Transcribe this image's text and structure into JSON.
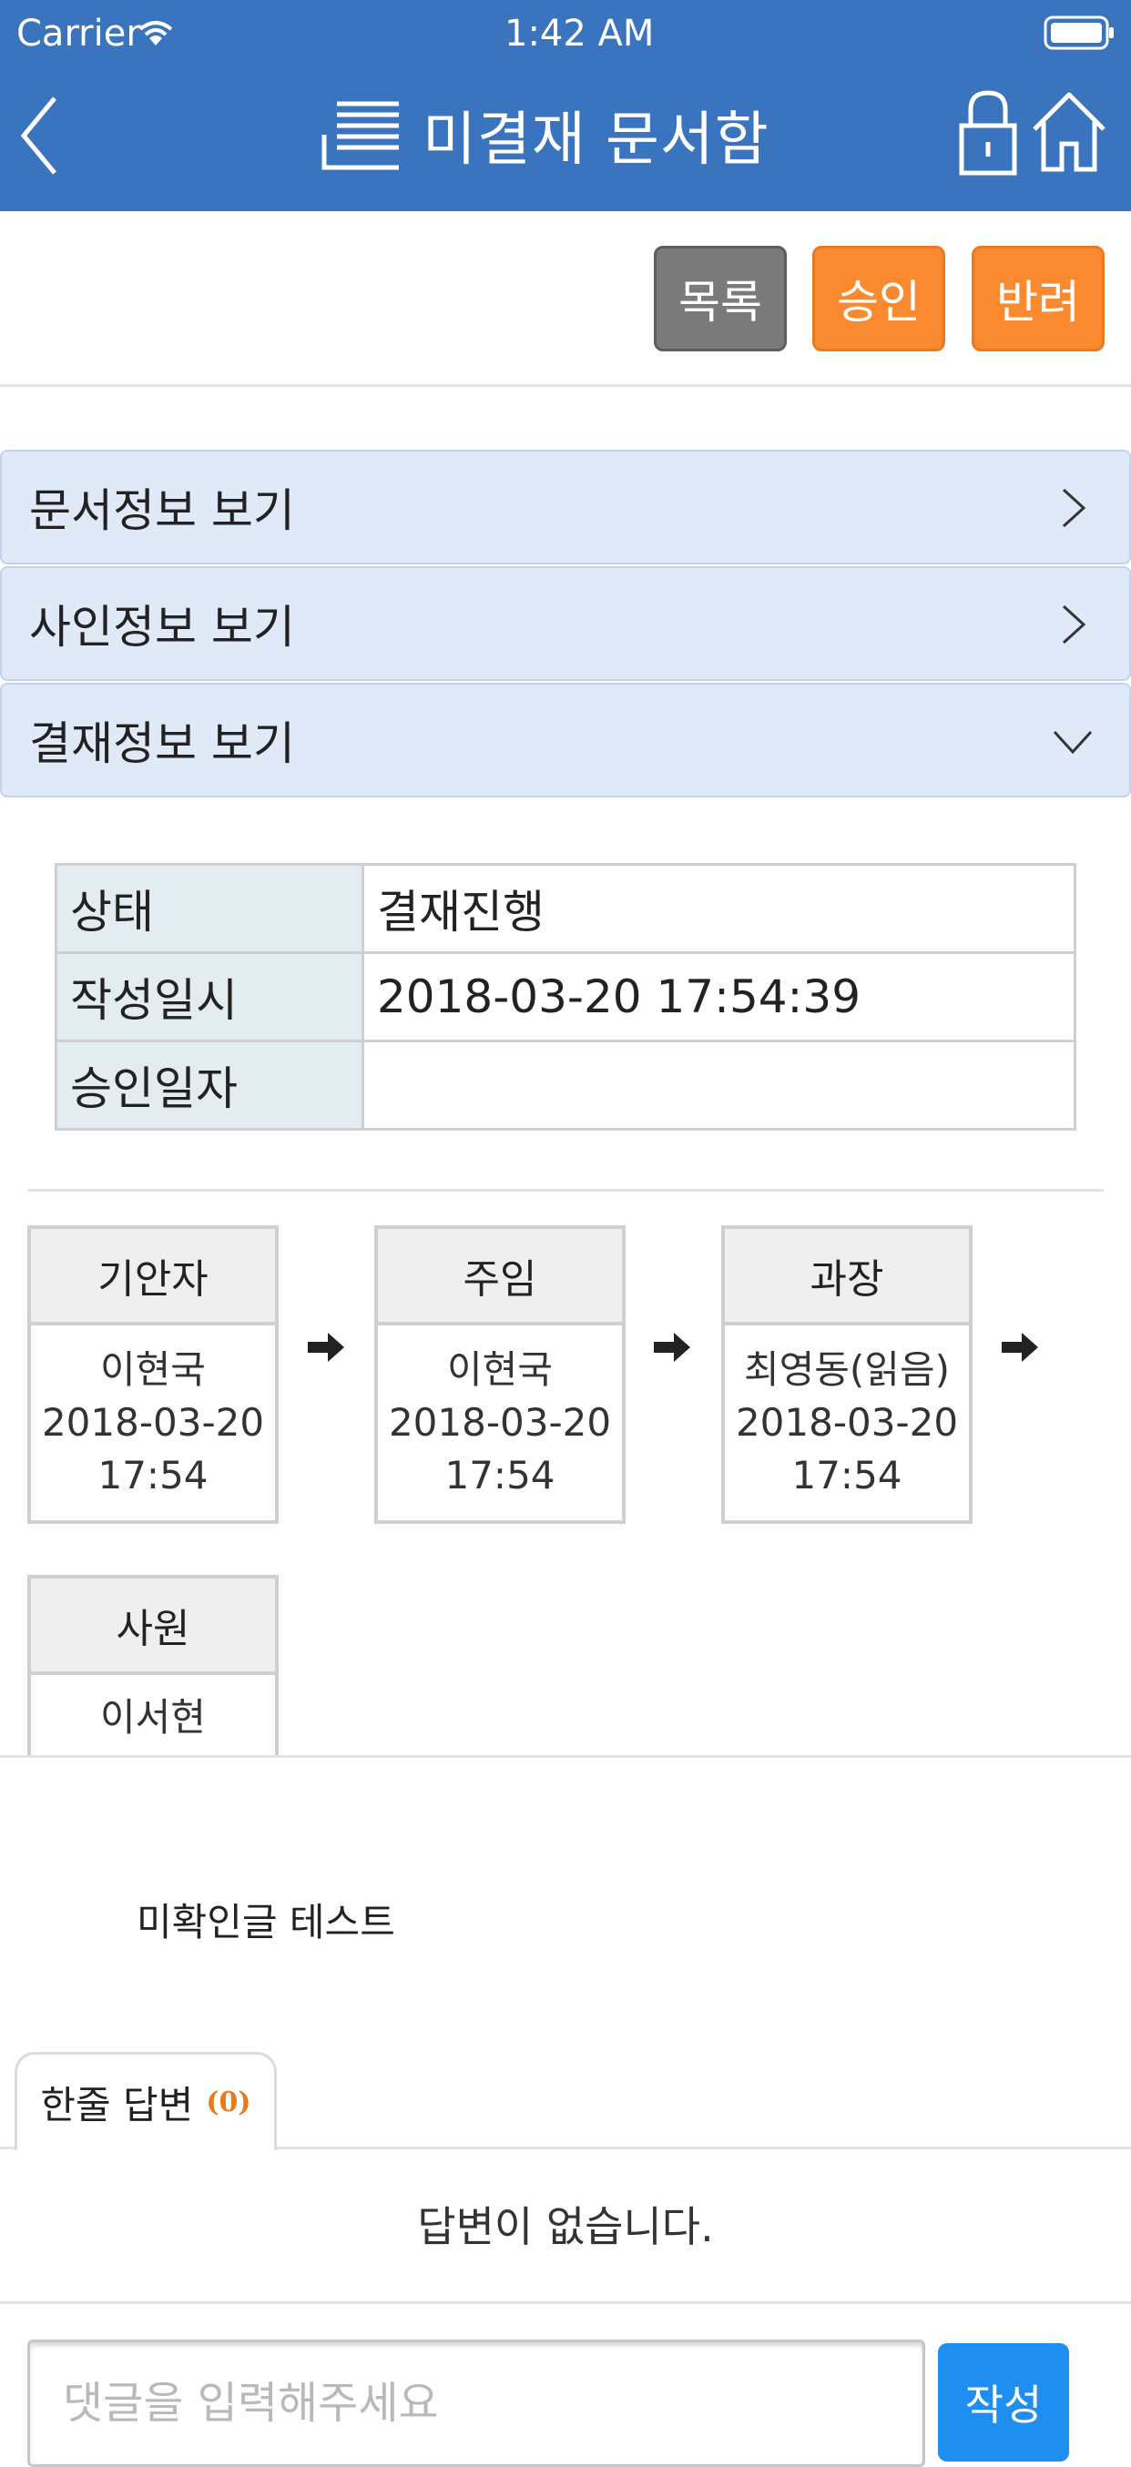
{
  "status_bar": {
    "carrier": "Carrier",
    "time": "1:42 AM"
  },
  "header": {
    "title": "미결재 문서함"
  },
  "toolbar": {
    "list_label": "목록",
    "approve_label": "승인",
    "reject_label": "반려"
  },
  "accordion": [
    {
      "label": "문서정보 보기",
      "state": "collapsed"
    },
    {
      "label": "사인정보 보기",
      "state": "collapsed"
    },
    {
      "label": "결재정보 보기",
      "state": "expanded"
    }
  ],
  "info_table": [
    {
      "key": "상태",
      "value": "결재진행"
    },
    {
      "key": "작성일시",
      "value": "2018-03-20 17:54:39"
    },
    {
      "key": "승인일자",
      "value": ""
    }
  ],
  "approvers": [
    {
      "role": "기안자",
      "name": "이현국",
      "date": "2018-03-20",
      "time": "17:54"
    },
    {
      "role": "주임",
      "name": "이현국",
      "date": "2018-03-20",
      "time": "17:54"
    },
    {
      "role": "과장",
      "name": "최영동(읽음)",
      "date": "2018-03-20",
      "time": "17:54"
    },
    {
      "role": "사원",
      "name": "이서현",
      "date": "",
      "time": ""
    }
  ],
  "document_body": "미확인글 테스트",
  "comments": {
    "tab_label": "한줄 답변",
    "count": "(0)",
    "empty_message": "답변이 없습니다.",
    "input_placeholder": "댓글을 입력해주세요",
    "input_value": "",
    "submit_label": "작성"
  },
  "colors": {
    "header_bg": "#3a74bf",
    "accent_orange": "#f98a2f",
    "list_gray": "#7a7a7a",
    "submit_blue": "#1e8ef0",
    "accordion_bg": "#e0e9f7"
  }
}
